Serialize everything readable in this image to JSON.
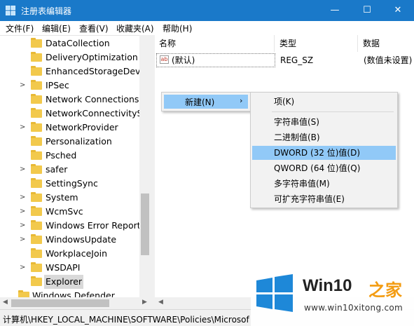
{
  "window": {
    "title": "注册表编辑器",
    "controls": {
      "minimize": "—",
      "maximize": "☐",
      "close": "✕"
    }
  },
  "menubar": [
    "文件(F)",
    "编辑(E)",
    "查看(V)",
    "收藏夹(A)",
    "帮助(H)"
  ],
  "tree": {
    "items": [
      {
        "label": "DataCollection",
        "expandable": false
      },
      {
        "label": "DeliveryOptimization",
        "expandable": false
      },
      {
        "label": "EnhancedStorageDevic",
        "expandable": false
      },
      {
        "label": "IPSec",
        "expandable": true
      },
      {
        "label": "Network Connections",
        "expandable": false
      },
      {
        "label": "NetworkConnectivitySta",
        "expandable": false
      },
      {
        "label": "NetworkProvider",
        "expandable": true
      },
      {
        "label": "Personalization",
        "expandable": false
      },
      {
        "label": "Psched",
        "expandable": false
      },
      {
        "label": "safer",
        "expandable": true
      },
      {
        "label": "SettingSync",
        "expandable": false
      },
      {
        "label": "System",
        "expandable": true
      },
      {
        "label": "WcmSvc",
        "expandable": true
      },
      {
        "label": "Windows Error Reporti",
        "expandable": true
      },
      {
        "label": "WindowsUpdate",
        "expandable": true
      },
      {
        "label": "WorkplaceJoin",
        "expandable": false
      },
      {
        "label": "WSDAPI",
        "expandable": true
      },
      {
        "label": "Explorer",
        "expandable": false,
        "selected": true
      }
    ],
    "last_item": "Windows Defender"
  },
  "values": {
    "columns": {
      "name": "名称",
      "type": "类型",
      "data": "数据"
    },
    "rows": [
      {
        "icon": "ab",
        "name": "(默认)",
        "type": "REG_SZ",
        "data": "(数值未设置)"
      }
    ]
  },
  "context_menu": {
    "new_label": "新建(N)",
    "new_arrow": "›",
    "submenu": [
      {
        "label": "项(K)"
      },
      {
        "label": "字符串值(S)"
      },
      {
        "label": "二进制值(B)"
      },
      {
        "label": "DWORD (32 位)值(D)",
        "highlighted": true
      },
      {
        "label": "QWORD (64 位)值(Q)"
      },
      {
        "label": "多字符串值(M)"
      },
      {
        "label": "可扩充字符串值(E)"
      }
    ]
  },
  "statusbar": {
    "path": "计算机\\HKEY_LOCAL_MACHINE\\SOFTWARE\\Policies\\Microsof"
  },
  "watermark": {
    "brand": "Win10",
    "brand_accent": "之家",
    "url": "www.win10xitong.com",
    "colors": {
      "logo": "#1e88d8",
      "accent": "#f39c12"
    }
  },
  "colors": {
    "titlebar": "#1a79c9",
    "menu_highlight": "#91c9f7",
    "folder": "#f2c94c"
  }
}
